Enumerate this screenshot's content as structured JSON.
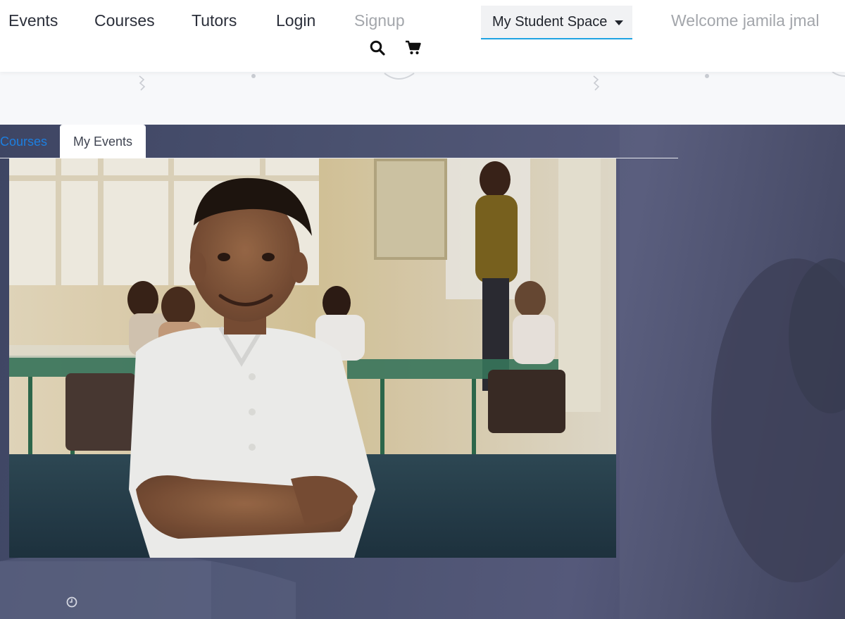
{
  "nav": {
    "items": [
      {
        "label": "Events"
      },
      {
        "label": "Courses"
      },
      {
        "label": "Tutors"
      },
      {
        "label": "Login"
      },
      {
        "label": "Signup"
      }
    ],
    "dropdown_label": "My Student Space",
    "welcome_text": "Welcome jamila jmal",
    "icons": [
      "search-icon",
      "cart-icon",
      "chevron-down-icon"
    ]
  },
  "tabs": [
    {
      "label": "Courses",
      "state": "inactive"
    },
    {
      "label": "My Events",
      "state": "active"
    }
  ],
  "hero": {
    "image_subject": "smiling boy in white polo shirt in a classroom",
    "meta_icon": "clock-icon"
  },
  "colors": {
    "accent": "#1fa3e2",
    "link": "#1d7fe0",
    "nav_text": "#2b2f3a",
    "muted_text": "#a3a6ab",
    "hero_bg": "#4b5270"
  }
}
